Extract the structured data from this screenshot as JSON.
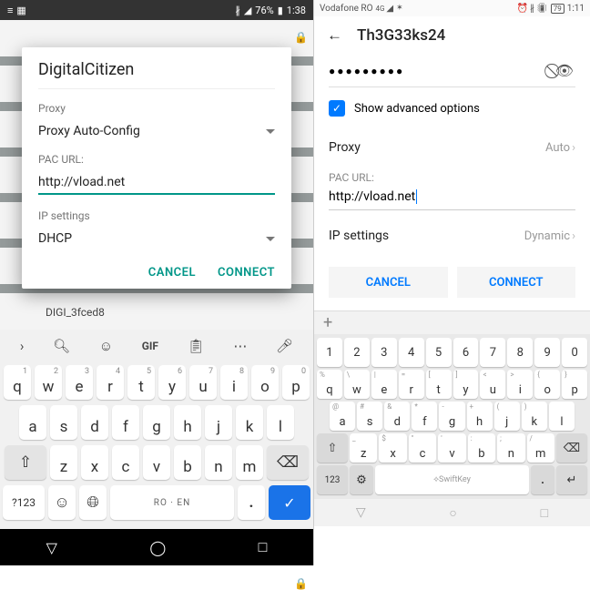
{
  "left": {
    "status": {
      "battery": "76%",
      "time": "1:38"
    },
    "bg_network": "DIGI_3fced8",
    "dialog": {
      "title": "DigitalCitizen",
      "proxy_label": "Proxy",
      "proxy_value": "Proxy Auto-Config",
      "pac_label": "PAC URL:",
      "pac_value": "http://vload.net",
      "ip_label": "IP settings",
      "ip_value": "DHCP",
      "cancel": "CANCEL",
      "connect": "CONNECT"
    },
    "keyboard": {
      "toolbar_gif": "GIF",
      "rows": [
        [
          [
            "q",
            "1"
          ],
          [
            "w",
            "2"
          ],
          [
            "e",
            "3"
          ],
          [
            "r",
            "4"
          ],
          [
            "t",
            "5"
          ],
          [
            "y",
            "6"
          ],
          [
            "u",
            "7"
          ],
          [
            "i",
            "8"
          ],
          [
            "o",
            "9"
          ],
          [
            "p",
            "0"
          ]
        ],
        [
          [
            "a",
            ""
          ],
          [
            "s",
            ""
          ],
          [
            "d",
            ""
          ],
          [
            "f",
            ""
          ],
          [
            "g",
            ""
          ],
          [
            "h",
            ""
          ],
          [
            "j",
            ""
          ],
          [
            "k",
            ""
          ],
          [
            "l",
            ""
          ]
        ],
        [
          [
            "z",
            ""
          ],
          [
            "x",
            ""
          ],
          [
            "c",
            ""
          ],
          [
            "v",
            ""
          ],
          [
            "b",
            ""
          ],
          [
            "n",
            ""
          ],
          [
            "m",
            ""
          ]
        ]
      ],
      "sym": "?123",
      "space": "RO · EN"
    }
  },
  "right": {
    "status": {
      "carrier": "Vodafone RO",
      "net": "4G",
      "battery": "79",
      "time": "1:11"
    },
    "title": "Th3G33ks24",
    "password_mask": "●●●●●●●●●",
    "show_adv": "Show advanced options",
    "proxy_label": "Proxy",
    "proxy_value": "Auto",
    "pac_label": "PAC URL:",
    "pac_value": "http://vload.net",
    "ip_label": "IP settings",
    "ip_value": "Dynamic",
    "cancel": "CANCEL",
    "connect": "CONNECT",
    "keyboard": {
      "num_row": [
        "1",
        "2",
        "3",
        "4",
        "5",
        "6",
        "7",
        "8",
        "9",
        "0"
      ],
      "rows": [
        [
          [
            "q",
            "%"
          ],
          [
            "w",
            "\\"
          ],
          [
            "e",
            "|"
          ],
          [
            "r",
            "="
          ],
          [
            "t",
            "["
          ],
          [
            "y",
            "]"
          ],
          [
            "u",
            "<"
          ],
          [
            "i",
            ">"
          ],
          [
            "o",
            "{"
          ],
          [
            "p",
            "}"
          ]
        ],
        [
          [
            "a",
            "@"
          ],
          [
            "s",
            "#"
          ],
          [
            "d",
            "&"
          ],
          [
            "f",
            "*"
          ],
          [
            "g",
            "-"
          ],
          [
            "h",
            "+"
          ],
          [
            "j",
            "("
          ],
          [
            "k",
            ")"
          ],
          [
            "l",
            ""
          ]
        ],
        [
          [
            "z",
            "_"
          ],
          [
            "x",
            "$"
          ],
          [
            "c",
            "\""
          ],
          [
            "v",
            "'"
          ],
          [
            "b",
            ":"
          ],
          [
            "n",
            ";"
          ],
          [
            "m",
            "/"
          ]
        ]
      ],
      "sym": "123",
      "space": "SwiftKey"
    }
  }
}
